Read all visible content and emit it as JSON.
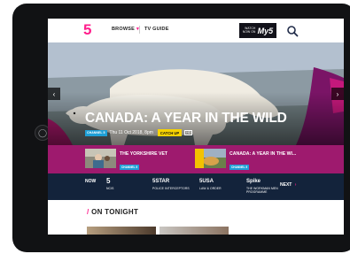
{
  "nav": {
    "logo": "5",
    "browse_label": "BROWSE",
    "browse_chevron": "▾",
    "tvguide_label": "TV GUIDE",
    "watch_now_label": "WATCH\nNOW ON",
    "my5_label": "My5"
  },
  "hero": {
    "title": "CANADA: A YEAR IN THE WILD",
    "channel_tag": "CHANNEL 5",
    "date": "Thu 11 Oct 2018, 8pm",
    "catchup_label": "CATCH UP",
    "hd_label": "HD",
    "prev_arrow": "‹",
    "next_arrow": "›"
  },
  "featured": [
    {
      "title": "THE YORKSHIRE VET",
      "tag": "CHANNEL 5"
    },
    {
      "title": "CANADA: A YEAR IN THE WI...",
      "tag": "CHANNEL 5"
    }
  ],
  "now_bar": {
    "now_label": "NOW",
    "next_label": "NEXT",
    "next_arrow": "›",
    "channels": [
      {
        "logo": "5",
        "show": "NCIS",
        "time": ""
      },
      {
        "logo": "5STAR",
        "show": "POLICE INTERCEPTORS",
        "time": ""
      },
      {
        "logo": "5USA",
        "show": "LAW & ORDER",
        "time": ""
      },
      {
        "logo": "Spike",
        "show": "THE WORKMAN MEN PROGRAMME",
        "time": ""
      }
    ]
  },
  "on_tonight": {
    "slash": "/",
    "title": "ON TONIGHT"
  },
  "colors": {
    "brand_pink": "#ff1e8c",
    "featured_strip": "#9e1a6e",
    "now_bar": "#13233b",
    "channel_tag": "#1e9fd6",
    "catchup": "#f7d300"
  }
}
